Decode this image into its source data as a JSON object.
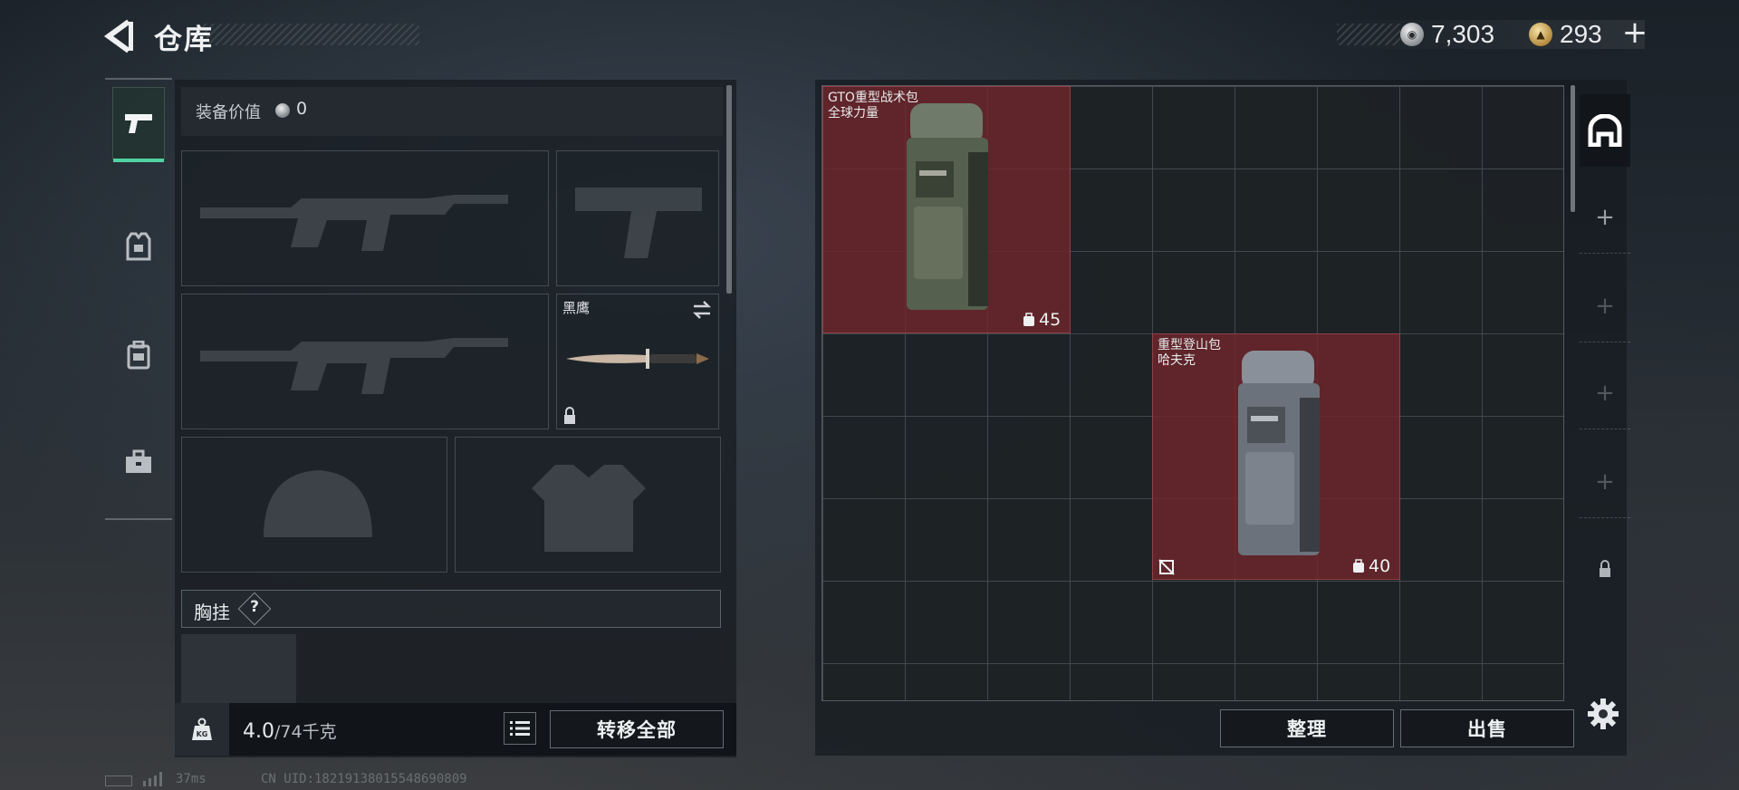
{
  "header": {
    "title": "仓库",
    "currencies": [
      {
        "icon": "silver-coin-icon",
        "value": "7,303"
      },
      {
        "icon": "gold-coin-icon",
        "value": "293"
      }
    ],
    "add_label": "+"
  },
  "rail": {
    "tabs": [
      {
        "icon": "pistol-icon",
        "active": true
      },
      {
        "icon": "armor-vest-icon",
        "active": false
      },
      {
        "icon": "backpack-icon",
        "active": false
      },
      {
        "icon": "briefcase-icon",
        "active": false
      }
    ]
  },
  "equipment": {
    "value_label": "装备价值",
    "value": "0",
    "melee": {
      "name": "黑鹰"
    },
    "chest_rig_label": "胸挂",
    "help_label": "?",
    "weight_current": "4.0",
    "weight_max": "/74千克",
    "transfer_all_label": "转移全部"
  },
  "storage": {
    "items": [
      {
        "name": "GTO重型战术包",
        "subtitle": "全球力量",
        "capacity": "45"
      },
      {
        "name": "重型登山包",
        "subtitle": "哈夫克",
        "capacity": "40"
      }
    ],
    "side_tabs": [
      {
        "icon": "stash-icon",
        "active": true
      },
      {
        "icon": "plus-icon",
        "label": "+"
      },
      {
        "icon": "plus-icon",
        "label": "+"
      },
      {
        "icon": "plus-icon",
        "label": "+"
      },
      {
        "icon": "plus-icon",
        "label": "+"
      },
      {
        "icon": "lock-icon"
      }
    ],
    "sort_label": "整理",
    "sell_label": "出售"
  },
  "status_bar": {
    "ping": "37ms",
    "uid": "CN UID:1821913801554869080​9"
  },
  "colors": {
    "accent": "#4fd3a2",
    "item_highlight": "#6e262c"
  }
}
